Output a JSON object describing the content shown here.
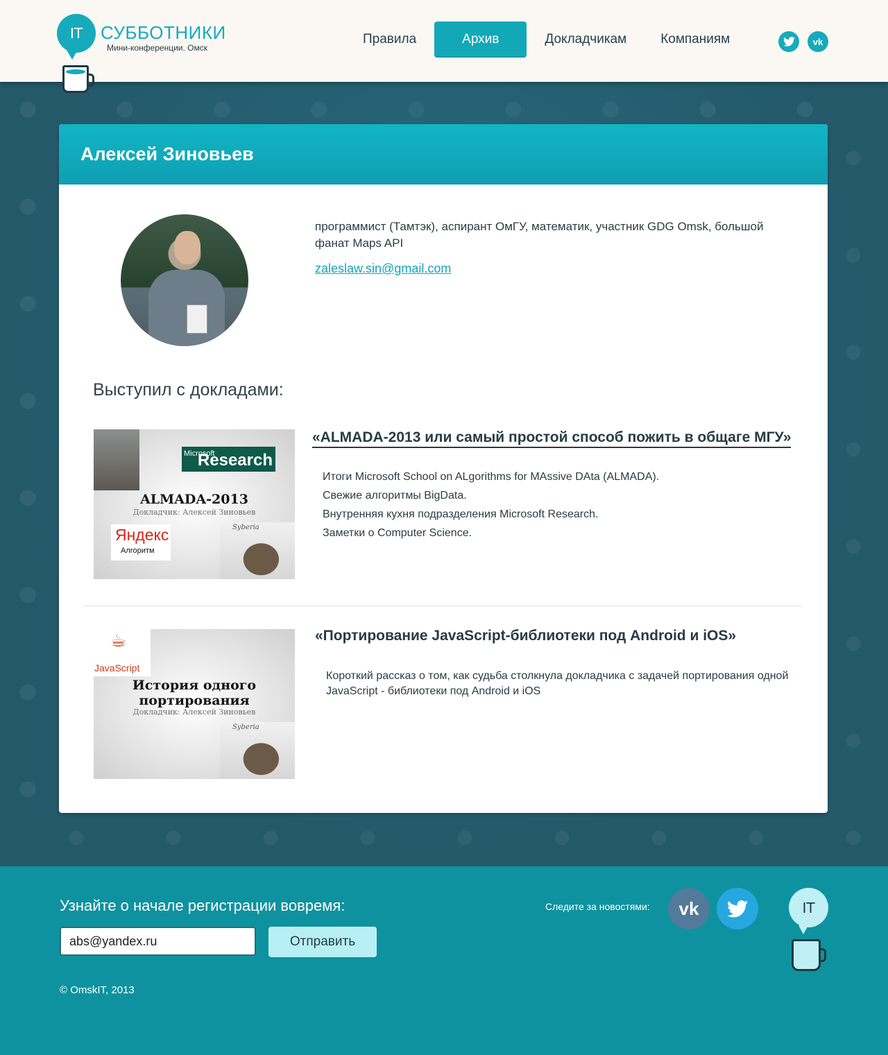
{
  "header": {
    "logo": {
      "bubble": "IT",
      "title": "СУББОТНИКИ",
      "subtitle": "Мини-конференции. Омск"
    },
    "nav": [
      "Правила",
      "Архив",
      "Докладчикам",
      "Компаниям"
    ],
    "active_nav": "Архив",
    "social": {
      "twitter_icon": "twitter-icon",
      "vk_icon": "vk-icon"
    }
  },
  "speaker": {
    "name": "Алексей Зиновьев",
    "bio": "программист (Тамтэк), аспирант ОмГУ, математик, участник GDG Omsk, большой фанат Maps API",
    "email": "zaleslaw.sin@gmail.com"
  },
  "talks_heading": "Выступил с докладами:",
  "talks": [
    {
      "title": "«ALMADA-2013 или самый простой способ пожить в общаге МГУ»",
      "thumb": {
        "ms_small": "Microsoft",
        "ms_big": "Research",
        "main": "ALMADA-2013",
        "sub": "Докладчик: Алексей Зиновьев",
        "yandex": "Яндекс",
        "yandex_sub": "Алгоритм",
        "mammoth_label": "Syberia"
      },
      "lines": [
        "Итоги Microsoft School on ALgorithms for MAssive DAta (ALMADA).",
        "Свежие алгоритмы BigData.",
        "Внутренняя кухня подразделения Microsoft Research.",
        "Заметки о Computer Science."
      ]
    },
    {
      "title": "«Портирование JavaScript-библиотеки под Android и iOS»",
      "thumb": {
        "java_label": "JavaScript",
        "main1": "История одного",
        "main2": "портирования",
        "sub": "Докладчик: Алексей Зиновьев",
        "mammoth_label": "Syberia"
      },
      "description": "Короткий рассказ о том, как судьба столкнула докладчика с задачей портирования одной JavaScript - библиотеки под Android и iOS"
    }
  ],
  "footer": {
    "reg_title": "Узнайте о начале регистрации вовремя:",
    "email_value": "abs@yandex.ru",
    "send_label": "Отправить",
    "follow_label": "Следите за новостями:",
    "logo_bubble": "IT",
    "copyright": "©  OmskIT, 2013"
  },
  "colors": {
    "accent": "#13a8b8",
    "footer_bg": "#0f929f",
    "page_bg": "#24596a"
  }
}
